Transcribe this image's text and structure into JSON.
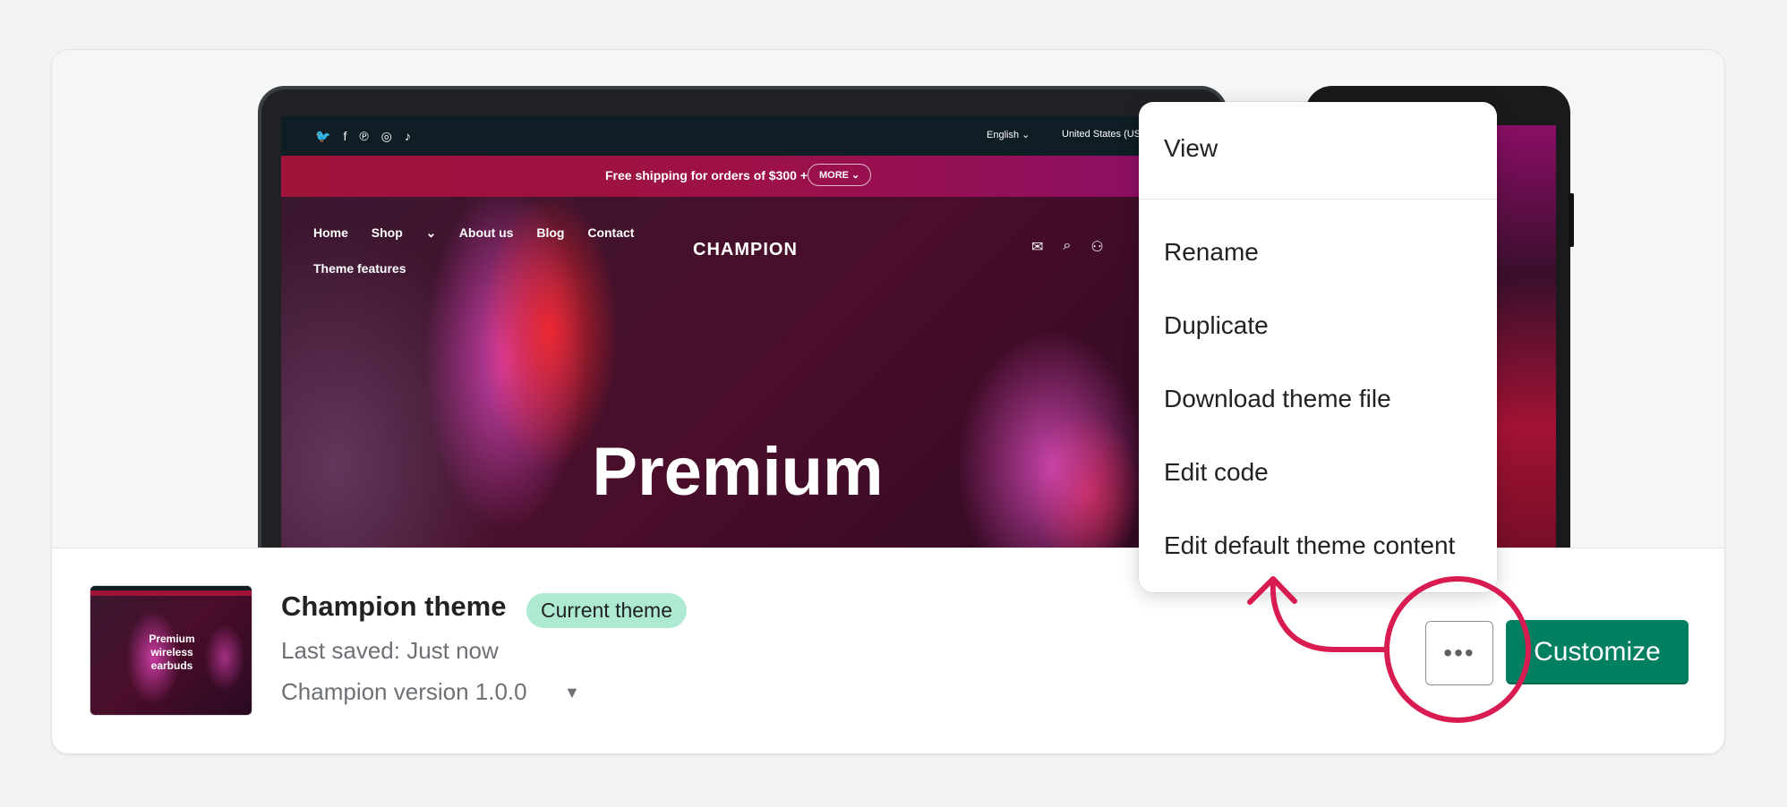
{
  "preview": {
    "topbar": {
      "social_icons": [
        "twitter-icon",
        "facebook-icon",
        "pinterest-icon",
        "instagram-icon",
        "tiktok-icon"
      ],
      "language": "English",
      "region": "United States (USD"
    },
    "announcement": {
      "text": "Free shipping for orders of $300 +",
      "more": "MORE"
    },
    "nav": {
      "items": [
        "Home",
        "Shop",
        "About us",
        "Blog",
        "Contact"
      ],
      "row2": "Theme features"
    },
    "logo": "CHAMPION",
    "hero_title": "Premium"
  },
  "theme": {
    "thumb_text": "Premium wireless earbuds",
    "name": "Champion theme",
    "badge": "Current theme",
    "last_saved": "Last saved: Just now",
    "version": "Champion version 1.0.0"
  },
  "actions": {
    "more_label": "•••",
    "customize": "Customize"
  },
  "menu": {
    "items": [
      "View",
      "Rename",
      "Duplicate",
      "Download theme file",
      "Edit code",
      "Edit default theme content"
    ]
  },
  "colors": {
    "primary": "#008060",
    "badge": "#aee9d1",
    "annotation": "#d81b50"
  }
}
